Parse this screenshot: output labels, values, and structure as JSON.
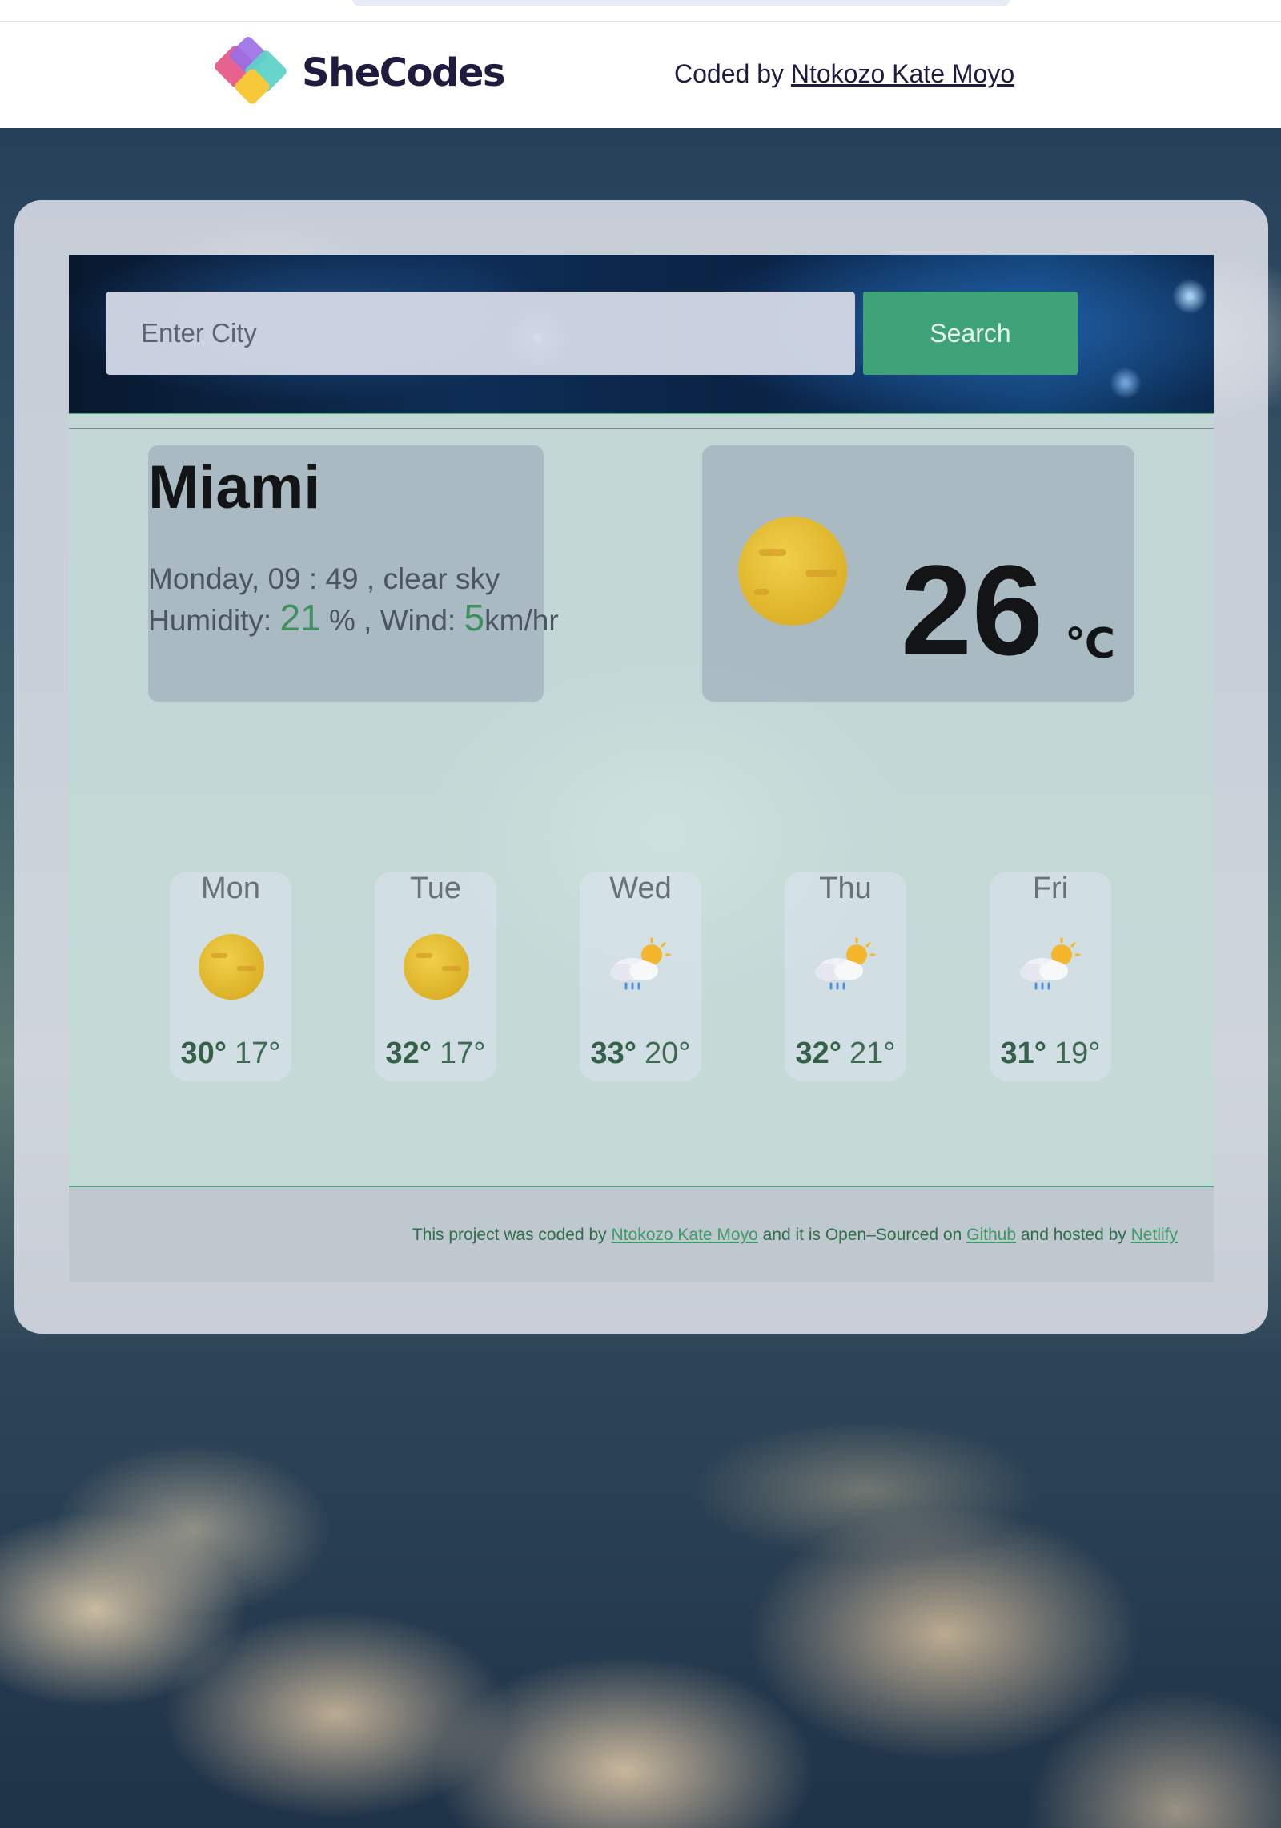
{
  "header": {
    "brand": "SheCodes",
    "credit_prefix": "Coded by",
    "credit_name": "Ntokozo Kate Moyo"
  },
  "search": {
    "placeholder": "Enter City",
    "button_label": "Search"
  },
  "current": {
    "city": "Miami",
    "day": "Monday",
    "time": "09 : 49",
    "description": "clear sky",
    "humidity_label": "Humidity:",
    "humidity": "21",
    "humidity_unit": "%",
    "wind_label": "Wind:",
    "wind": "5",
    "wind_unit": "km/hr",
    "temperature": "26",
    "unit": "℃",
    "icon": "sun-icon"
  },
  "forecast": [
    {
      "day": "Mon",
      "high": "30°",
      "low": "17°",
      "icon": "sun-icon"
    },
    {
      "day": "Tue",
      "high": "32°",
      "low": "17°",
      "icon": "sun-icon"
    },
    {
      "day": "Wed",
      "high": "33°",
      "low": "20°",
      "icon": "sun-cloud-rain-icon"
    },
    {
      "day": "Thu",
      "high": "32°",
      "low": "21°",
      "icon": "sun-cloud-rain-icon"
    },
    {
      "day": "Fri",
      "high": "31°",
      "low": "19°",
      "icon": "sun-cloud-rain-icon"
    }
  ],
  "footer": {
    "t1": "This project was coded by",
    "author": "Ntokozo Kate Moyo",
    "t2": "and it is Open–Sourced on",
    "github": "Github",
    "t3": "and hosted by",
    "host": "Netlify"
  },
  "colors": {
    "accent_green": "#3ea477",
    "number_green": "#3f8f5f",
    "brand_dark": "#1e1b3f"
  }
}
